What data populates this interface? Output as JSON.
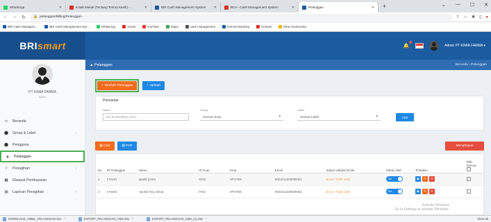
{
  "browser": {
    "tabs": [
      {
        "label": "WhatsApp",
        "color": "#25d366"
      },
      {
        "label": "Kotak Masuk (Tentang Terima Kasih) - ...",
        "color": "#d93025"
      },
      {
        "label": "BRI Cash Management System",
        "color": "#1b5ba0"
      },
      {
        "label": "BCA - Cash Management System",
        "color": "#d93025"
      },
      {
        "label": "Pelanggan",
        "color": "#1b5ba0"
      }
    ],
    "window_controls": [
      "⌄",
      "—",
      "☐",
      "✕"
    ],
    "new_tab": "+",
    "url": "pelanggan/Billing/Pelanggan",
    "bookmarks": [
      "BRI Cash Managem...",
      "BRI Cash Management Sys...",
      "WhatsApp",
      "Gmail",
      "YouTube",
      "Maps",
      "cash management",
      "Internet Banking",
      "Hotmail",
      "Other bookmarks"
    ]
  },
  "header": {
    "logo_prefix": "BRI",
    "logo_suffix": "smart",
    "notification_count": "2",
    "user_label": "Admin PT KIMIA FARMA"
  },
  "sidebar": {
    "profile_name": "PT KIMIA FARMA",
    "profile_role": "admin",
    "items": [
      {
        "label": "Beranda",
        "icon": "▭",
        "has_arrow": false
      },
      {
        "label": "Group & Label",
        "icon": "⬤",
        "has_arrow": true
      },
      {
        "label": "Pengguna",
        "icon": "⬤",
        "has_arrow": false
      },
      {
        "label": "Pelanggan",
        "icon": "▲",
        "has_arrow": false,
        "active": true
      },
      {
        "label": "Penagihan",
        "icon": "✧",
        "has_arrow": true
      },
      {
        "label": "Riwayat Pembayaran",
        "icon": "▦",
        "has_arrow": false
      },
      {
        "label": "Laporan Penagihan",
        "icon": "▤",
        "has_arrow": true
      }
    ]
  },
  "content": {
    "section_title": "Pelanggan",
    "breadcrumb": "Beranda › Pelanggan",
    "add_button": "+ Tambah Pelanggan",
    "upload_button": "+ Upload",
    "filter": {
      "title": "Pencarian",
      "name_label": "Nama",
      "name_placeholder": "Cari berdasarkan nama...",
      "group_label": "Group",
      "group_value": "Semua Grup",
      "label_label": "Label",
      "label_value": "Semua Label",
      "search_button": "Cari"
    },
    "export_csv": "CSV",
    "export_pdf": "PDF",
    "delete_button": "Menghapus",
    "table": {
      "headers": [
        "No",
        "ID Pelanggan",
        "Nama",
        "ID Grup",
        "Grup",
        "Email",
        "Status Validasi Email",
        "Status Aktif",
        "Tindakan",
        "Pilih Semua"
      ],
      "rows": [
        {
          "no": "1",
          "id": "170110",
          "name": "apotik prima",
          "group_id": "0702",
          "group": "APOTEK",
          "email": "0001012200000001",
          "status_email": "Belum Tidak Valid",
          "status_active": "ON"
        },
        {
          "no": "2",
          "id": "170200",
          "name": "Apotek Roy Sehat",
          "group_id": "0702",
          "group": "APOTEK",
          "email": "0001012200000002",
          "status_email": "Belum Tidak Valid",
          "status_active": "ON"
        }
      ]
    }
  },
  "downloads": [
    "DOWNLOAD_AMBIL_PELANGGAN.xlsx",
    "EXPORT_PELANGGAN_CMS.xlsx",
    "EXPORT_PELANGGAN_CMS_(1).xlsx"
  ],
  "downloads_more": "Show all",
  "watermark": [
    "Activate Windows",
    "Go to Settings to activate Windows."
  ]
}
